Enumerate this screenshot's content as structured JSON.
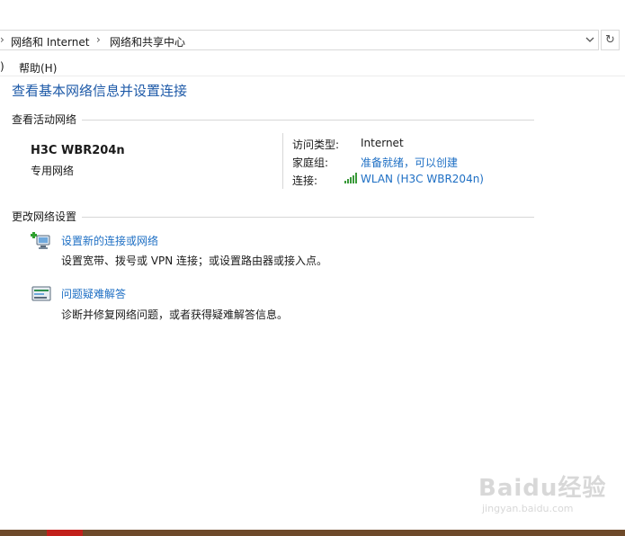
{
  "breadcrumb": {
    "items": [
      "网络和 Internet",
      "网络和共享中心"
    ]
  },
  "menu": {
    "items": [
      "帮助(H)"
    ]
  },
  "page_title": "查看基本网络信息并设置连接",
  "active_networks": {
    "heading": "查看活动网络",
    "network_name": "H3C WBR204n",
    "network_type": "专用网络",
    "access_type_label": "访问类型:",
    "access_type_value": "Internet",
    "homegroup_label": "家庭组:",
    "homegroup_value": "准备就绪，可以创建",
    "connection_label": "连接:",
    "connection_value": "WLAN (H3C WBR204n)"
  },
  "change_settings": {
    "heading": "更改网络设置",
    "tasks": [
      {
        "label": "设置新的连接或网络",
        "description": "设置宽带、拨号或 VPN 连接；或设置路由器或接入点。"
      },
      {
        "label": "问题疑难解答",
        "description": "诊断并修复网络问题，或者获得疑难解答信息。"
      }
    ]
  },
  "watermark": {
    "main": "Baidu经验",
    "sub": "jingyan.baidu.com"
  },
  "icons": [
    "chevron-right-icon",
    "chevron-down-icon",
    "refresh-icon",
    "wifi-signal-icon",
    "new-connection-icon",
    "troubleshoot-icon"
  ],
  "colors": {
    "link": "#1e6fc4",
    "title": "#1e5aa8"
  }
}
